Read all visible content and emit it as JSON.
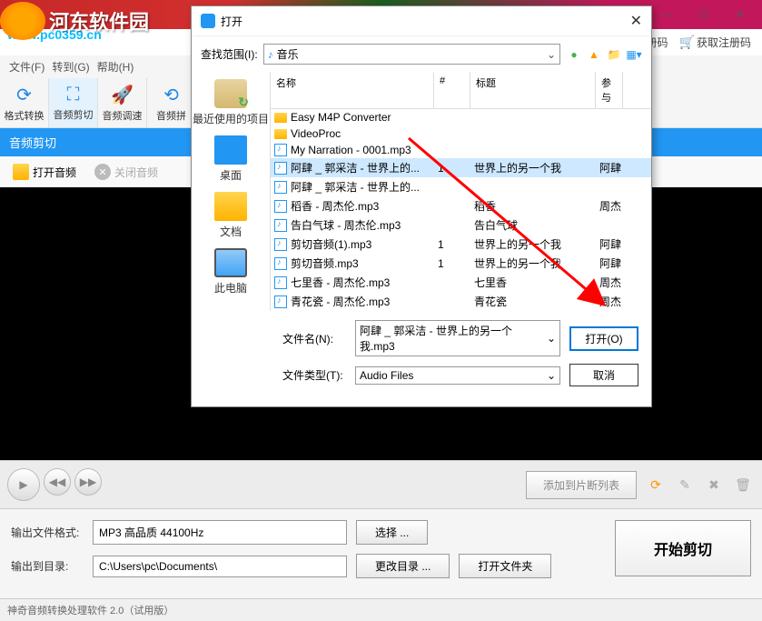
{
  "watermark": {
    "text": "河东软件园",
    "url": "www.pc0359.cn"
  },
  "mainWindow": {
    "winCtrls": {
      "min": "—",
      "max": "☐",
      "close": "✕"
    },
    "reg": {
      "icon1": "🔒",
      "label1": "注册码",
      "icon2": "🛒",
      "label2": "获取注册码"
    },
    "menu": {
      "file": "文件(F)",
      "goto": "转到(G)",
      "help": "帮助(H)"
    },
    "toolbar": [
      {
        "icon": "⟳",
        "label": "格式转换"
      },
      {
        "icon": "⛶",
        "label": "音频剪切"
      },
      {
        "icon": "🚀",
        "label": "音频调速"
      },
      {
        "icon": "⟲",
        "label": "音频拼"
      }
    ],
    "subheader": "音频剪切",
    "actions": {
      "open": "打开音频",
      "close": "关闭音频"
    },
    "player": {
      "addSeg": "添加到片断列表"
    },
    "output": {
      "fmtLabel": "输出文件格式:",
      "fmtValue": "MP3 高品质 44100Hz",
      "chooseBtn": "选择 ...",
      "dirLabel": "输出到目录:",
      "dirValue": "C:\\Users\\pc\\Documents\\",
      "changeDirBtn": "更改目录 ...",
      "openDirBtn": "打开文件夹",
      "startBtn": "开始剪切"
    },
    "status": "神奇音频转换处理软件 2.0（试用版）"
  },
  "dialog": {
    "title": "打开",
    "lookIn": {
      "label": "查找范围(I):",
      "value": "音乐"
    },
    "sidebar": [
      {
        "cls": "recent",
        "label": "最近使用的项目"
      },
      {
        "cls": "desktop",
        "label": "桌面"
      },
      {
        "cls": "docs",
        "label": "文档"
      },
      {
        "cls": "pc",
        "label": "此电脑"
      }
    ],
    "headers": {
      "name": "名称",
      "num": "#",
      "title": "标题",
      "extra": "参与"
    },
    "files": [
      {
        "type": "folder",
        "name": "Easy M4P Converter",
        "num": "",
        "title": "",
        "extra": ""
      },
      {
        "type": "folder",
        "name": "VideoProc",
        "num": "",
        "title": "",
        "extra": ""
      },
      {
        "type": "audio",
        "name": "My Narration - 0001.mp3",
        "num": "",
        "title": "",
        "extra": ""
      },
      {
        "type": "audio",
        "name": "阿肆 _ 郭采洁 - 世界上的...",
        "num": "1",
        "title": "世界上的另一个我",
        "extra": "阿肆",
        "selected": true
      },
      {
        "type": "audio",
        "name": "阿肆 _ 郭采洁 - 世界上的...",
        "num": "",
        "title": "",
        "extra": ""
      },
      {
        "type": "audio",
        "name": "稻香 - 周杰伦.mp3",
        "num": "",
        "title": "稻香",
        "extra": "周杰"
      },
      {
        "type": "audio",
        "name": "告白气球 - 周杰伦.mp3",
        "num": "",
        "title": "告白气球",
        "extra": ""
      },
      {
        "type": "audio",
        "name": "剪切音频(1).mp3",
        "num": "1",
        "title": "世界上的另一个我",
        "extra": "阿肆"
      },
      {
        "type": "audio",
        "name": "剪切音频.mp3",
        "num": "1",
        "title": "世界上的另一个我",
        "extra": "阿肆"
      },
      {
        "type": "audio",
        "name": "七里香 - 周杰伦.mp3",
        "num": "",
        "title": "七里香",
        "extra": "周杰"
      },
      {
        "type": "audio",
        "name": "青花瓷 - 周杰伦.mp3",
        "num": "",
        "title": "青花瓷",
        "extra": "周杰"
      }
    ],
    "fileName": {
      "label": "文件名(N):",
      "value": "阿肆 _ 郭采洁 - 世界上的另一个我.mp3"
    },
    "fileType": {
      "label": "文件类型(T):",
      "value": "Audio Files"
    },
    "openBtn": "打开(O)",
    "cancelBtn": "取消"
  }
}
